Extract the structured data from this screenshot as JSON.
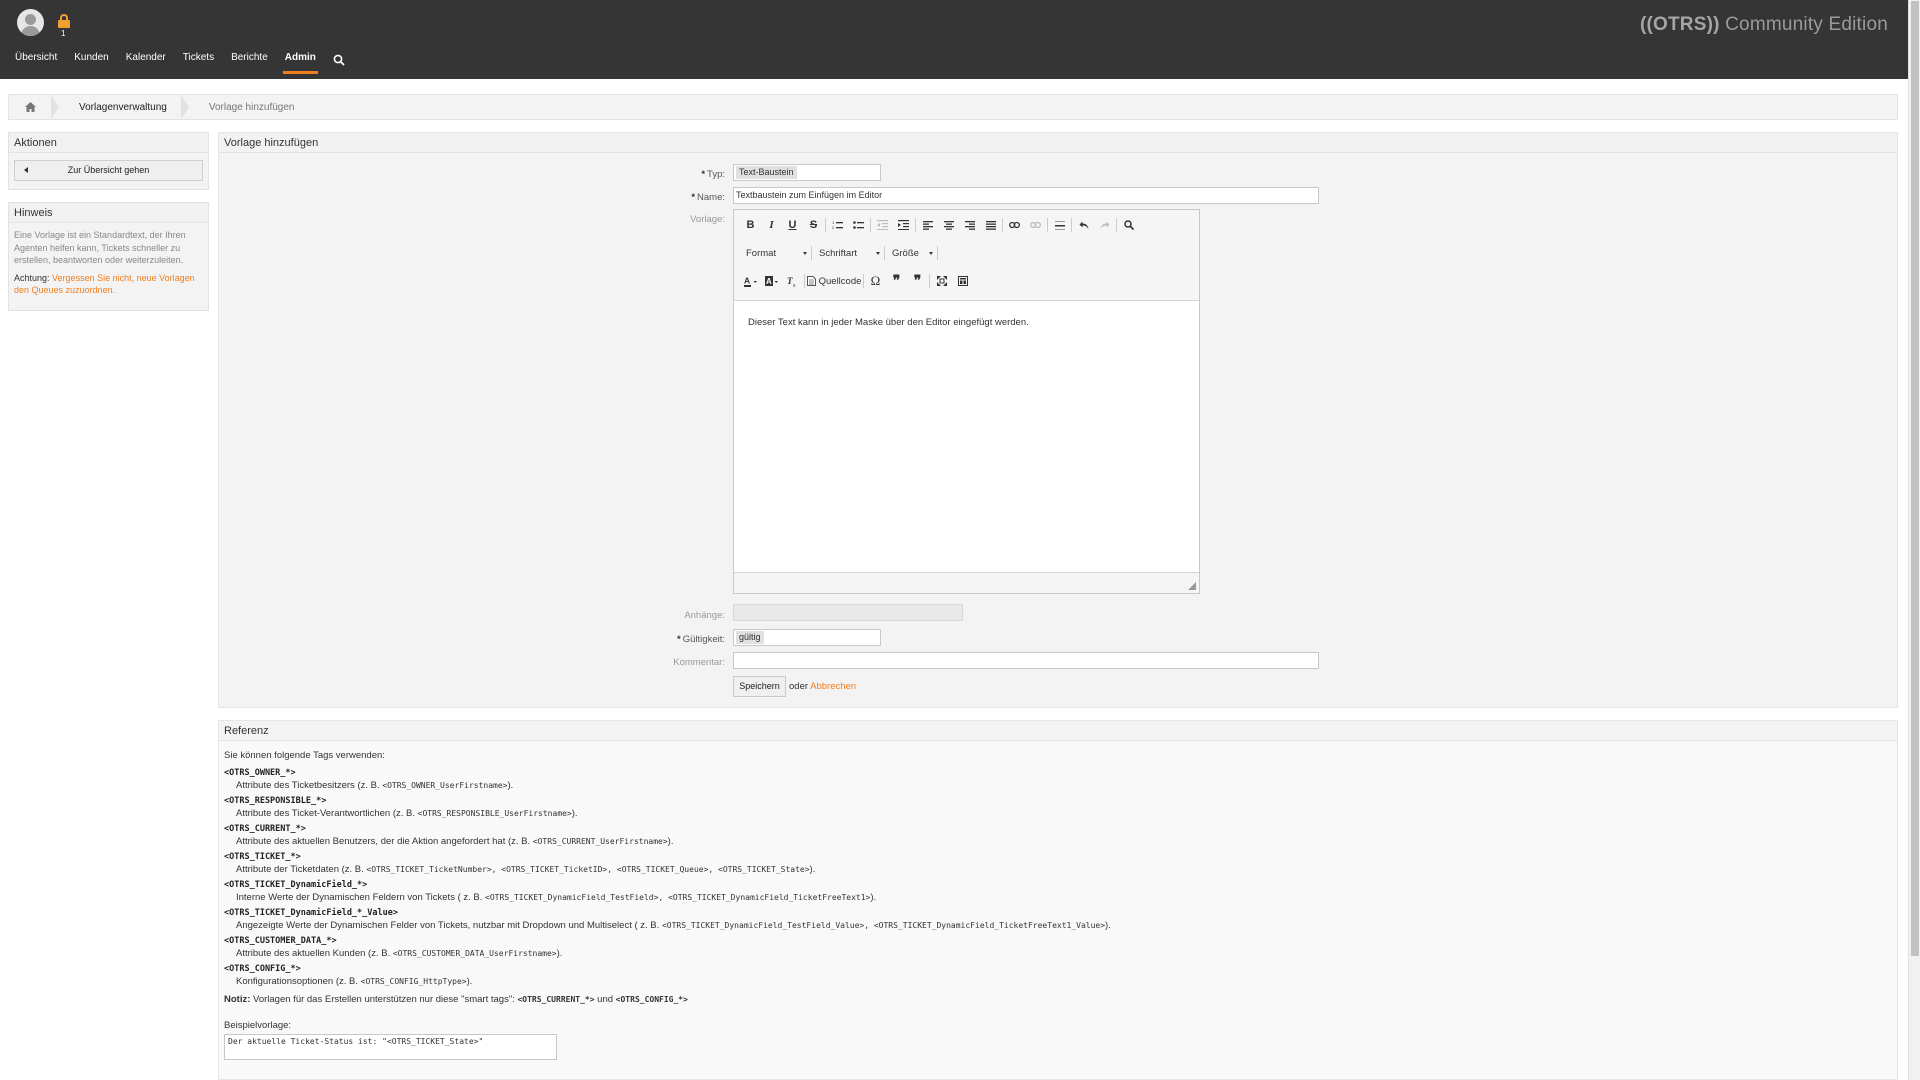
{
  "header": {
    "logo_bracket": "((OTRS))",
    "logo_text": " Community Edition",
    "lock_count": "1",
    "nav": [
      "Übersicht",
      "Kunden",
      "Kalender",
      "Tickets",
      "Berichte",
      "Admin"
    ],
    "active_nav": "Admin"
  },
  "breadcrumb": [
    "Vorlagenverwaltung",
    "Vorlage hinzufügen"
  ],
  "sidebar": {
    "actions_title": "Aktionen",
    "overview_button": "Zur Übersicht gehen",
    "hint_title": "Hinweis",
    "hint_text": "Eine Vorlage ist ein Standardtext, der Ihren Agenten helfen kann, Tickets schneller zu erstellen, beantworten oder weiterzuleiten.",
    "warn_label": "Achtung:",
    "warn_text": "Vergessen Sie nicht, neue Vorlagen den Queues zuzuordnen."
  },
  "form": {
    "title": "Vorlage hinzufügen",
    "type_label": "Typ:",
    "type_value": "Text-Baustein",
    "name_label": "Name:",
    "name_value": "Textbaustein zum Einfügen im Editor",
    "template_label": "Vorlage:",
    "toolbar": {
      "format": "Format",
      "font": "Schriftart",
      "size": "Größe",
      "source": "Quellcode"
    },
    "editor_text": "Dieser Text kann in jeder Maske über den Editor eingefügt werden.",
    "attachments_label": "Anhänge:",
    "validity_label": "Gültigkeit:",
    "validity_value": "gültig",
    "comment_label": "Kommentar:",
    "comment_value": "",
    "save_button": "Speichern",
    "or_text": "oder",
    "cancel_link": "Abbrechen"
  },
  "reference": {
    "title": "Referenz",
    "intro": "Sie können folgende Tags verwenden:",
    "tags": [
      {
        "tag": "<OTRS_OWNER_*>",
        "desc": "Attribute des Ticketbesitzers (z. B. ",
        "code": "<OTRS_OWNER_UserFirstname>",
        "end": ")."
      },
      {
        "tag": "<OTRS_RESPONSIBLE_*>",
        "desc": "Attribute des Ticket-Verantwortlichen (z. B. ",
        "code": "<OTRS_RESPONSIBLE_UserFirstname>",
        "end": ")."
      },
      {
        "tag": "<OTRS_CURRENT_*>",
        "desc": "Attribute des aktuellen Benutzers, der die Aktion angefordert hat (z. B. ",
        "code": "<OTRS_CURRENT_UserFirstname>",
        "end": ")."
      },
      {
        "tag": "<OTRS_TICKET_*>",
        "desc": "Attribute der Ticketdaten (z. B. ",
        "code": "<OTRS_TICKET_TicketNumber>, <OTRS_TICKET_TicketID>, <OTRS_TICKET_Queue>, <OTRS_TICKET_State>",
        "end": ")."
      },
      {
        "tag": "<OTRS_TICKET_DynamicField_*>",
        "desc": "Interne Werte der Dynamischen Feldern von Tickets ( z. B. ",
        "code": "<OTRS_TICKET_DynamicField_TestField>, <OTRS_TICKET_DynamicField_TicketFreeText1>",
        "end": ")."
      },
      {
        "tag": "<OTRS_TICKET_DynamicField_*_Value>",
        "desc": "Angezeigte Werte der Dynamischen Felder von Tickets, nutzbar mit Dropdown und Multiselect ( z. B. ",
        "code": "<OTRS_TICKET_DynamicField_TestField_Value>, <OTRS_TICKET_DynamicField_TicketFreeText1_Value>",
        "end": ")."
      },
      {
        "tag": "<OTRS_CUSTOMER_DATA_*>",
        "desc": "Attribute des aktuellen Kunden (z. B. ",
        "code": "<OTRS_CUSTOMER_DATA_UserFirstname>",
        "end": ")."
      },
      {
        "tag": "<OTRS_CONFIG_*>",
        "desc": "Konfigurationsoptionen (z. B. ",
        "code": "<OTRS_CONFIG_HttpType>",
        "end": ")."
      }
    ],
    "note_label": "Notiz:",
    "note_text": " Vorlagen für das Erstellen unterstützen nur diese \"smart tags\": ",
    "note_tag1": "<OTRS_CURRENT_*>",
    "note_and": " und ",
    "note_tag2": "<OTRS_CONFIG_*>",
    "example_label": "Beispielvorlage:",
    "example_value": "Der aktuelle Ticket-Status ist: \"<OTRS_TICKET_State>\""
  },
  "colors": {
    "header_bg": "#353535",
    "accent": "#f07f1f"
  }
}
